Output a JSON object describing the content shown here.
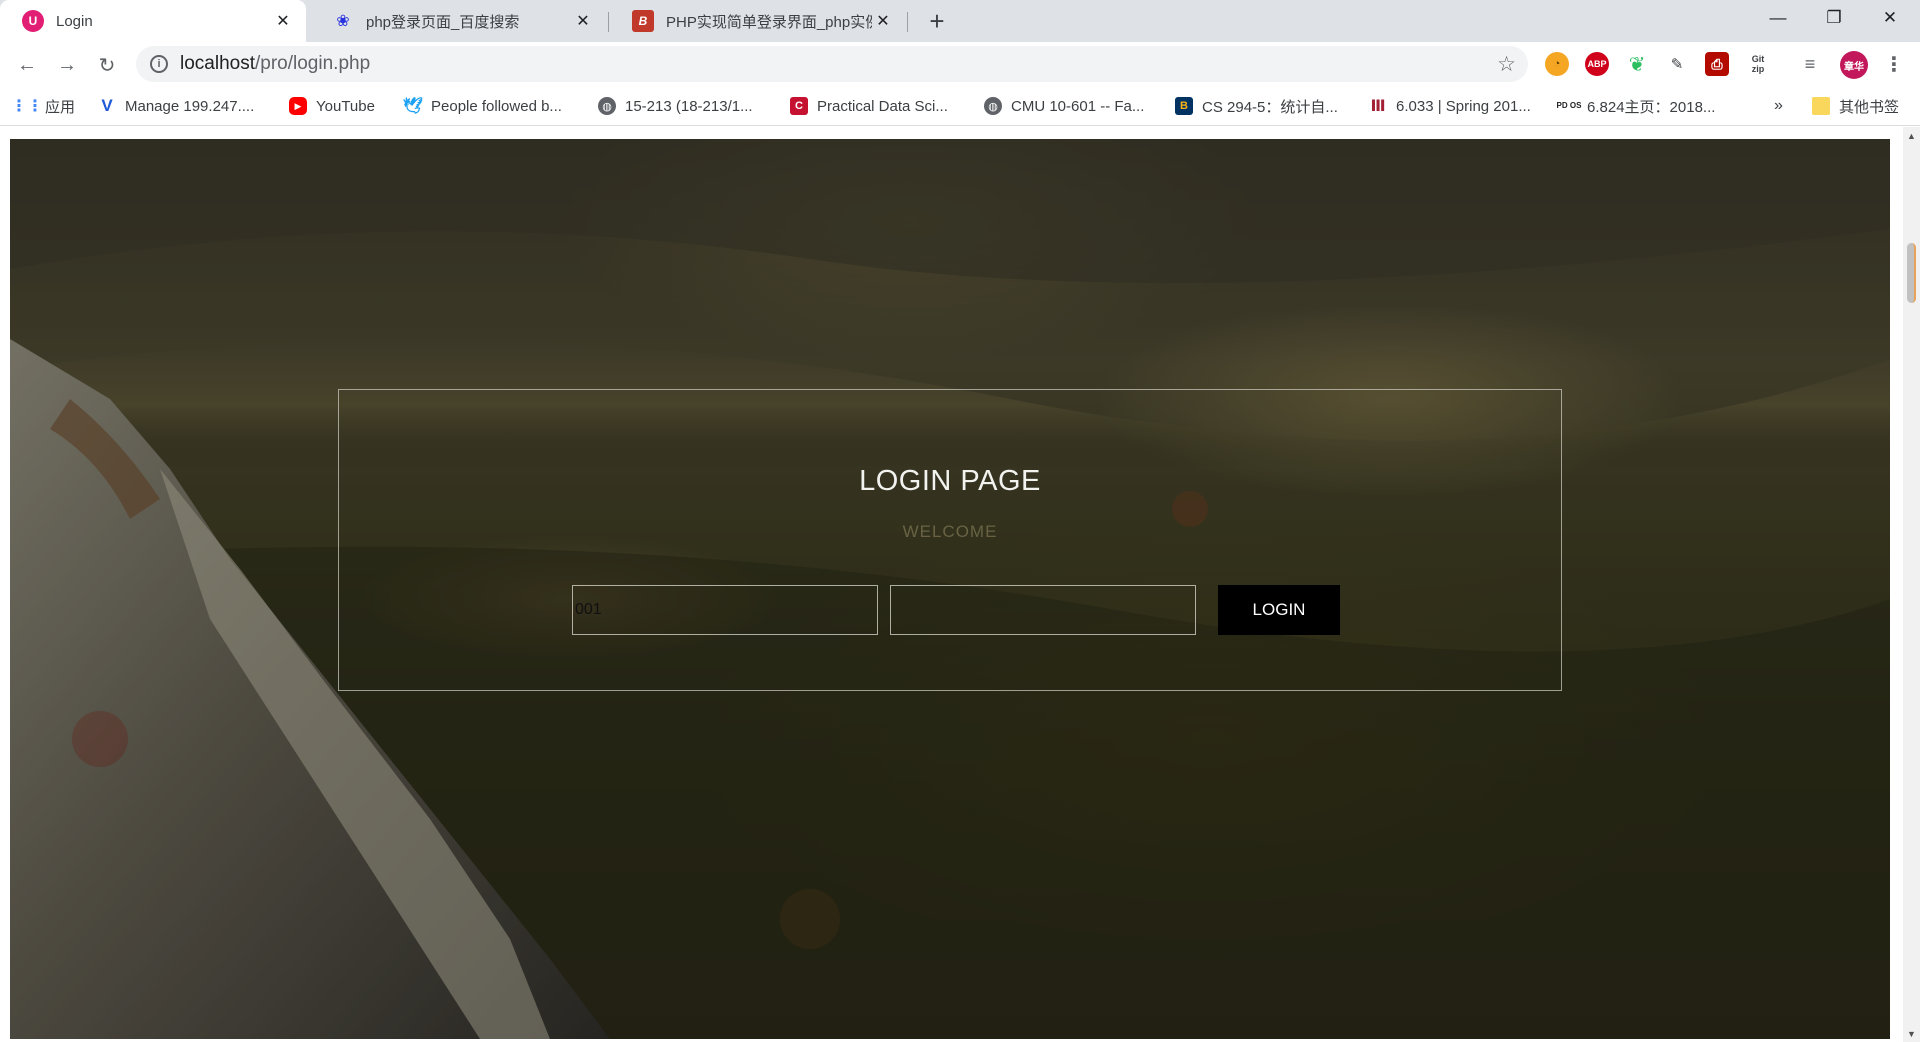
{
  "tabs": [
    {
      "title": "Login",
      "icon": "bootstrap-icon",
      "active": true
    },
    {
      "title": "php登录页面_百度搜索",
      "icon": "baidu-paw-icon",
      "active": false
    },
    {
      "title": "PHP实现简单登录界面_php实例",
      "icon": "jb51-icon",
      "active": false
    }
  ],
  "window": {
    "minimize": "—",
    "restore": "❐",
    "close": "✕"
  },
  "toolbar": {
    "url_host": "localhost",
    "url_path": "/pro/login.php",
    "extensions": [
      "tampermonkey-icon",
      "adblock-plus-icon",
      "evernote-icon",
      "translate-icon",
      "pdf-icon",
      "gitzip-icon",
      "reading-list-icon",
      "profile-avatar",
      "menu-icon"
    ],
    "abp_label": "ABP",
    "gitzip_label": "Git zip",
    "avatar_label": "章华"
  },
  "bookmarks": {
    "items": [
      {
        "label": "应用",
        "icon": "apps-grid-icon"
      },
      {
        "label": "Manage 199.247....",
        "icon": "vultr-icon"
      },
      {
        "label": "YouTube",
        "icon": "youtube-icon"
      },
      {
        "label": "People followed b...",
        "icon": "twitter-icon"
      },
      {
        "label": "15-213 (18-213/1...",
        "icon": "globe-icon"
      },
      {
        "label": "Practical Data Sci...",
        "icon": "cmu-icon"
      },
      {
        "label": "CMU 10-601 -- Fa...",
        "icon": "globe-icon"
      },
      {
        "label": "CS 294-5：统计自...",
        "icon": "berkeley-icon"
      },
      {
        "label": "6.033 | Spring 201...",
        "icon": "mit-icon"
      },
      {
        "label": "6.824主页：2018...",
        "icon": "pdos-icon"
      }
    ],
    "overflow": "»",
    "other_folder": "其他书签"
  },
  "login": {
    "title": "LOGIN PAGE",
    "subtitle": "WELCOME",
    "username_value": "001",
    "password_value": "",
    "button_label": "LOGIN"
  },
  "colors": {
    "tabstrip": "#dee1e6",
    "login_button": "#000000",
    "avatar": "#c2185b"
  }
}
